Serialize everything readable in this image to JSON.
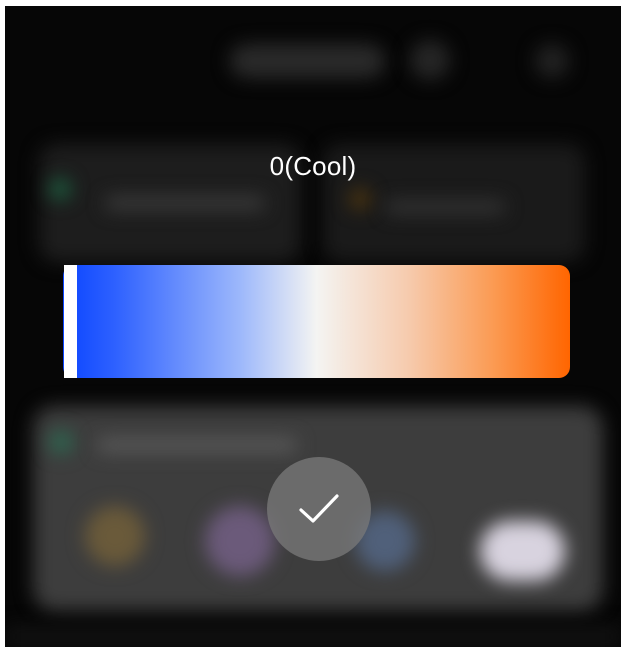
{
  "color_temperature": {
    "label": "0(Cool)",
    "value": 0,
    "gradient_stops": {
      "cool": "#0b45ff",
      "neutral": "#f4f4f2",
      "warm": "#ff6500"
    },
    "indicator_color": "#ffffff"
  },
  "confirm": {
    "icon": "checkmark-icon"
  }
}
